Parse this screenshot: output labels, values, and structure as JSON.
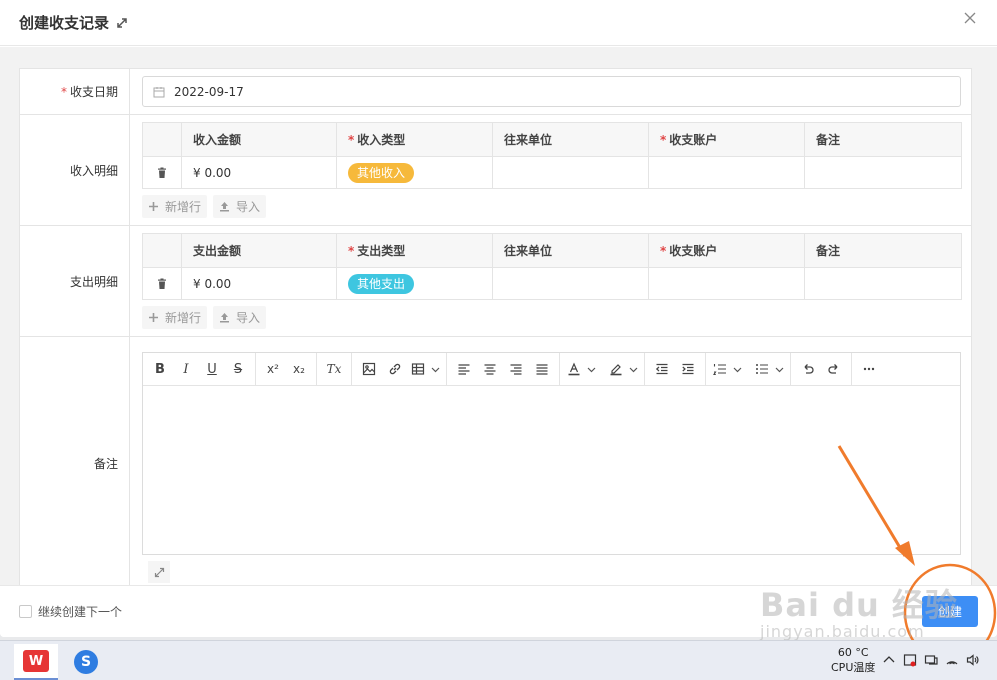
{
  "dialog": {
    "title": "创建收支记录",
    "colors": {
      "primary": "#3d8ef5",
      "required": "#e04646",
      "annotation": "#f07b2c"
    }
  },
  "form": {
    "date": {
      "label": "收支日期",
      "value": "2022-09-17"
    },
    "income": {
      "label": "收入明细",
      "headers": [
        "收入金额",
        "收入类型",
        "往来单位",
        "收支账户",
        "备注"
      ],
      "row": {
        "amount": "¥ 0.00",
        "type": "其他收入",
        "party": "",
        "account": "",
        "note": ""
      },
      "add_row": "新增行",
      "import": "导入"
    },
    "expense": {
      "label": "支出明细",
      "headers": [
        "支出金额",
        "支出类型",
        "往来单位",
        "收支账户",
        "备注"
      ],
      "row": {
        "amount": "¥ 0.00",
        "type": "其他支出",
        "party": "",
        "account": "",
        "note": ""
      },
      "add_row": "新增行",
      "import": "导入"
    },
    "remark": {
      "label": "备注",
      "content": ""
    }
  },
  "editor_toolbar": {
    "bold": "B",
    "italic": "I",
    "underline": "U",
    "strike": "S",
    "superscript": "x²",
    "subscript": "x₂",
    "clear_format": "Tx"
  },
  "footer": {
    "continue_label": "继续创建下一个",
    "create_label": "创建"
  },
  "taskbar": {
    "wps_label": "W",
    "sogou_label": "S",
    "cpu_temp_value": "60 °C",
    "cpu_temp_label": "CPU温度"
  },
  "watermark": {
    "main": "Bai du 经验",
    "sub": "jingyan.baidu.com"
  }
}
